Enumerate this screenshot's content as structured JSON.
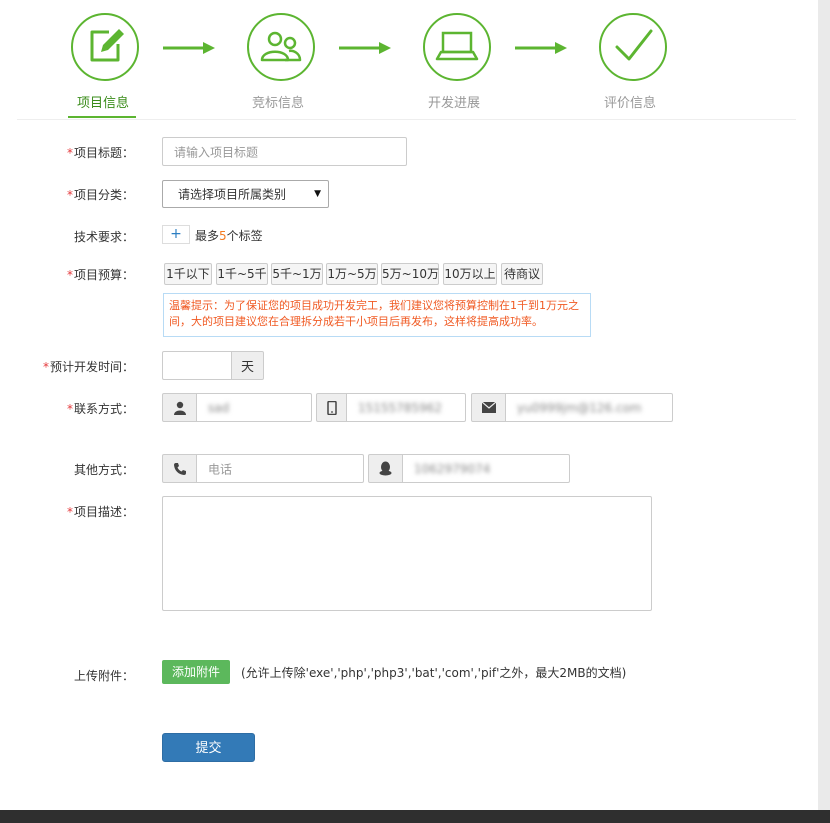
{
  "steps": [
    {
      "label": "项目信息",
      "icon": "edit-icon",
      "active": true
    },
    {
      "label": "竞标信息",
      "icon": "users-icon",
      "active": false
    },
    {
      "label": "开发进展",
      "icon": "laptop-icon",
      "active": false
    },
    {
      "label": "评价信息",
      "icon": "check-icon",
      "active": false
    }
  ],
  "form": {
    "title": {
      "label": "项目标题：",
      "placeholder": "请输入项目标题"
    },
    "category": {
      "label": "项目分类：",
      "selected": "请选择项目所属类别"
    },
    "tech": {
      "label": "技术要求：",
      "plus": "+",
      "hint_prefix": "最多",
      "hint_num": "5",
      "hint_suffix": "个标签"
    },
    "budget": {
      "label": "项目预算：",
      "options": [
        "1千以下",
        "1千~5千",
        "5千~1万",
        "1万~5万",
        "5万~10万",
        "10万以上",
        "待商议"
      ],
      "tip": "温馨提示：为了保证您的项目成功开发完工，我们建议您将预算控制在1千到1万元之间，大的项目建议您在合理拆分成若干小项目后再发布，这样将提高成功率。"
    },
    "duration": {
      "label": "预计开发时间：",
      "unit": "天"
    },
    "contact": {
      "label": "联系方式：",
      "name": "sad",
      "phone": "15155785962",
      "email": "yu0999jm@126.com"
    },
    "other": {
      "label": "其他方式：",
      "phone_placeholder": "电话",
      "qq": "1062979074"
    },
    "description": {
      "label": "项目描述："
    },
    "attachment": {
      "label": "上传附件：",
      "button": "添加附件",
      "note": "(允许上传除'exe','php','php3','bat','com','pif'之外，最大2MB的文档)"
    },
    "submit": "提交"
  },
  "colors": {
    "accent": "#5cb531",
    "required": "#e4393c",
    "primary": "#337ab7",
    "tip_text": "#f05a23"
  }
}
